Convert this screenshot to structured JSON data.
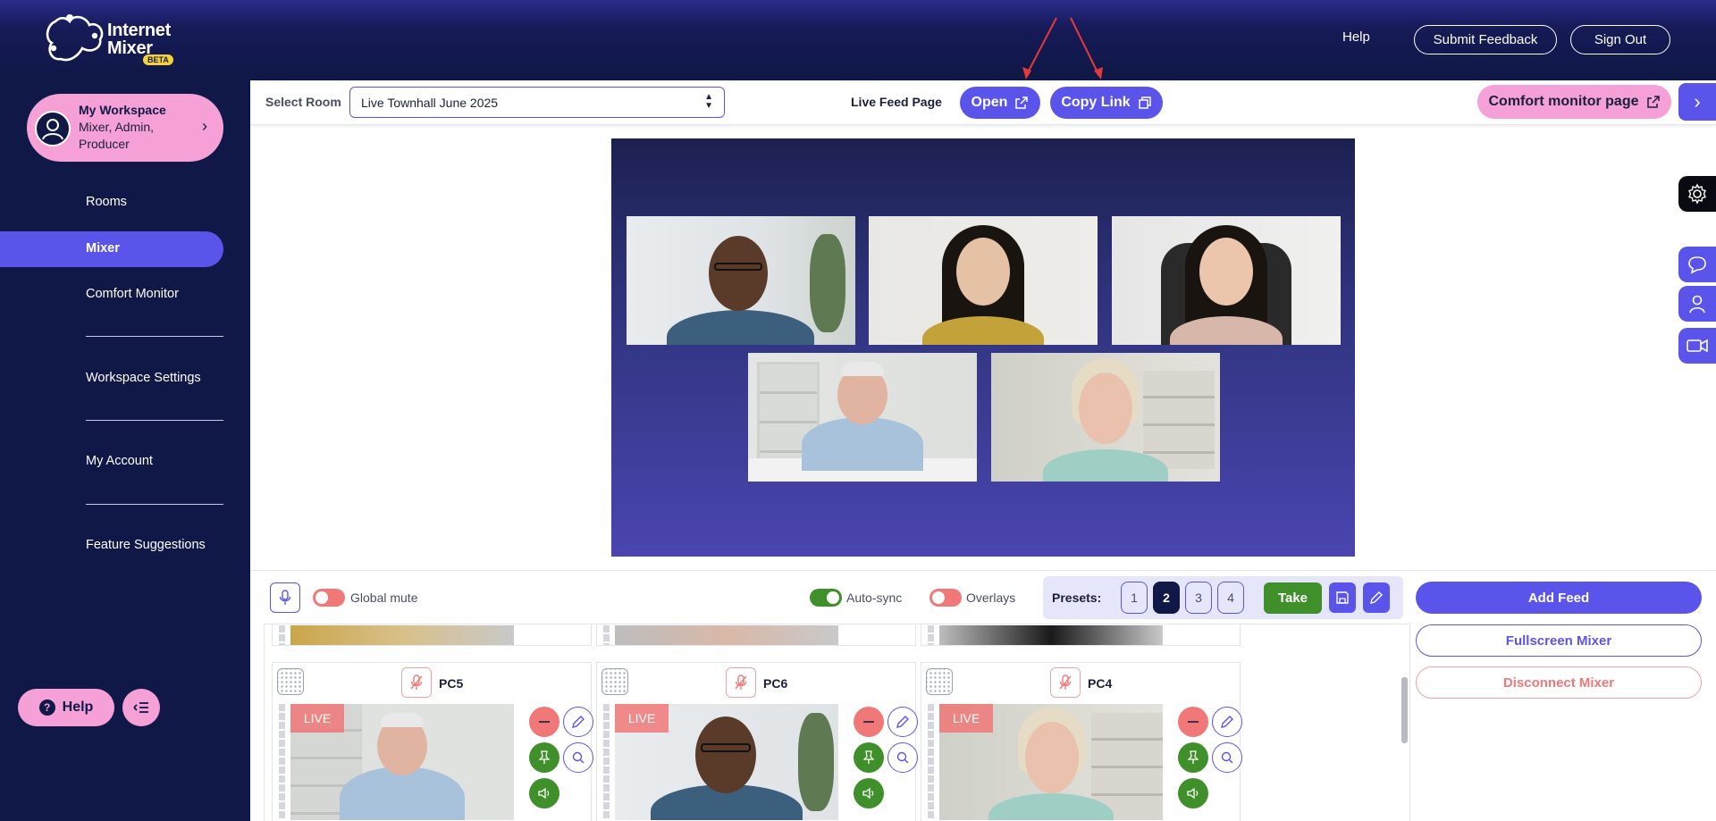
{
  "brand": {
    "name_line1": "Internet",
    "name_line2": "Mixer",
    "badge": "BETA"
  },
  "header": {
    "help": "Help",
    "submit_feedback": "Submit Feedback",
    "sign_out": "Sign Out"
  },
  "workspace": {
    "title": "My Workspace",
    "roles": "Mixer, Admin, Producer"
  },
  "nav": {
    "items": [
      "Rooms",
      "Mixer",
      "Comfort Monitor",
      "Workspace Settings",
      "My Account",
      "Feature Suggestions"
    ],
    "active": "Mixer"
  },
  "footer": {
    "help": "Help"
  },
  "room_bar": {
    "select_label": "Select Room",
    "selected_room": "Live Townhall June 2025",
    "live_feed_label": "Live Feed Page",
    "open": "Open",
    "copy_link": "Copy Link",
    "comfort_monitor": "Comfort monitor page"
  },
  "controls": {
    "global_mute_label": "Global mute",
    "global_mute_on": false,
    "auto_sync_label": "Auto-sync",
    "auto_sync_on": true,
    "overlays_label": "Overlays",
    "overlays_on": false,
    "presets_label": "Presets:",
    "presets": [
      "1",
      "2",
      "3",
      "4"
    ],
    "active_preset": "2",
    "take": "Take",
    "add_feed": "Add Feed",
    "fullscreen_mixer": "Fullscreen Mixer",
    "disconnect_mixer": "Disconnect Mixer"
  },
  "feeds": [
    {
      "name": "PC5",
      "status": "LIVE"
    },
    {
      "name": "PC6",
      "status": "LIVE"
    },
    {
      "name": "PC4",
      "status": "LIVE"
    }
  ],
  "icons": {
    "mic": "mic-icon",
    "external_link": "external-link-icon",
    "copy": "copy-icon",
    "gear": "gear-icon",
    "chat": "chat-icon",
    "user": "user-icon",
    "camera": "camera-icon",
    "save": "save-icon",
    "edit": "pencil-icon",
    "minus": "minus-icon",
    "pin": "pin-icon",
    "search": "search-icon",
    "volume": "volume-icon"
  },
  "colors": {
    "navy": "#0f1846",
    "accent": "#5b54ea",
    "pink": "#f5a0d7",
    "green": "#3f8f2a",
    "red": "#f07878"
  }
}
